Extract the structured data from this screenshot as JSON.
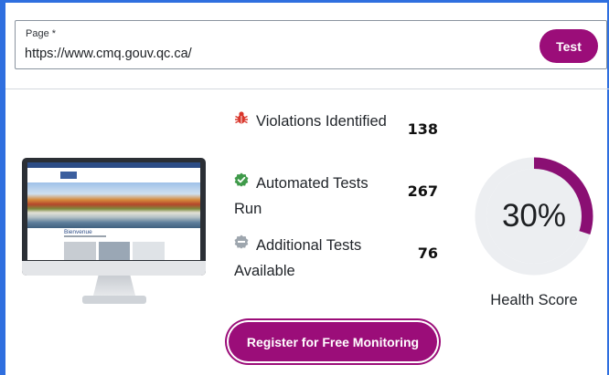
{
  "url_field": {
    "label": "Page *",
    "value": "https://www.cmq.gouv.qc.ca/"
  },
  "test_button": {
    "label": "Test"
  },
  "preview": {
    "site_heading": "Bienvenue"
  },
  "stats": [
    {
      "label": "Violations Identified",
      "value": "138",
      "icon": "bug-icon",
      "color": "#d9362b"
    },
    {
      "label": "Automated Tests Run",
      "value": "267",
      "icon": "check-badge-icon",
      "color": "#3f9a4a"
    },
    {
      "label": "Additional Tests Available",
      "value": "76",
      "icon": "minus-badge-icon",
      "color": "#9ea6ae"
    }
  ],
  "health": {
    "score": "30%",
    "fraction": 0.3,
    "label": "Health Score",
    "arc_color": "#8a0f73",
    "track_color": "#eceef1"
  },
  "register_button": {
    "label": "Register for Free Monitoring"
  },
  "colors": {
    "accent": "#9b0d79",
    "frame": "#2f6fdf"
  }
}
